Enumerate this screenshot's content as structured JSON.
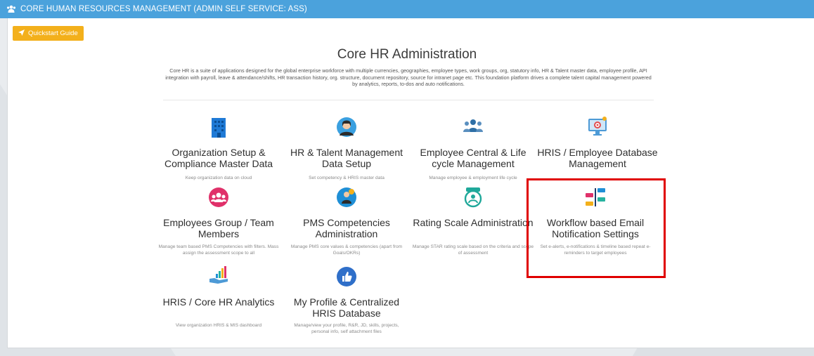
{
  "header": {
    "title": "CORE HUMAN RESOURCES MANAGEMENT (ADMIN SELF SERVICE: ASS)",
    "icon": "users-icon"
  },
  "quickstart": {
    "label": "Quickstart Guide",
    "icon": "paper-plane-icon"
  },
  "main": {
    "title": "Core HR Administration",
    "description": "Core HR is a suite of applications designed for the global enterprise workforce with multiple currencies, geographies, employee types, work groups, org, statutory info, HR & Talent master data, employee profile, API integration with payroll, leave & attendance/shifts, HR transaction history, org. structure, document repository, source for intranet page etc. This foundation platform drives a complete talent capital management powered by analytics, reports, to-dos and auto notifications."
  },
  "tiles": [
    {
      "title": "Organization Setup & Compliance Master Data",
      "desc": "Keep organization data on cloud",
      "icon": "building-icon"
    },
    {
      "title": "HR & Talent Management Data Setup",
      "desc": "Set competency & HRIS master data",
      "icon": "person-avatar-icon"
    },
    {
      "title": "Employee Central & Life cycle Management",
      "desc": "Manage employee & employment life cycle",
      "icon": "people-group-icon"
    },
    {
      "title": "HRIS / Employee Database Management",
      "desc": "",
      "icon": "monitor-target-icon"
    },
    {
      "title": "Employees Group / Team Members",
      "desc": "Manage team based PMS Competencies with filters. Mass assign the assessment scope to all",
      "icon": "team-circle-icon"
    },
    {
      "title": "PMS Competencies Administration",
      "desc": "Manage PMS core values & competencies (apart from Goals/OKRs)",
      "icon": "competency-badge-icon"
    },
    {
      "title": "Rating Scale Administration",
      "desc": "Manage STAR rating scale based on the criteria and scope of assessment",
      "icon": "rating-badge-icon"
    },
    {
      "title": "Workflow based Email Notification Settings",
      "desc": "Set e-alerts, e-notifications & timeline based repeat e-reminders to target employees",
      "icon": "workflow-icon"
    },
    {
      "title": "HRIS / Core HR Analytics",
      "desc": "View organization HRIS & MIS dashboard",
      "icon": "analytics-hand-icon"
    },
    {
      "title": "My Profile & Centralized HRIS Database",
      "desc": "Manage/view your profile, R&R, JD, skills, projects, personal info, self attachment files",
      "icon": "thumbs-up-icon"
    }
  ],
  "colors": {
    "header": "#4ba2dc",
    "button": "#f3b01b",
    "highlight": "#e00000"
  }
}
